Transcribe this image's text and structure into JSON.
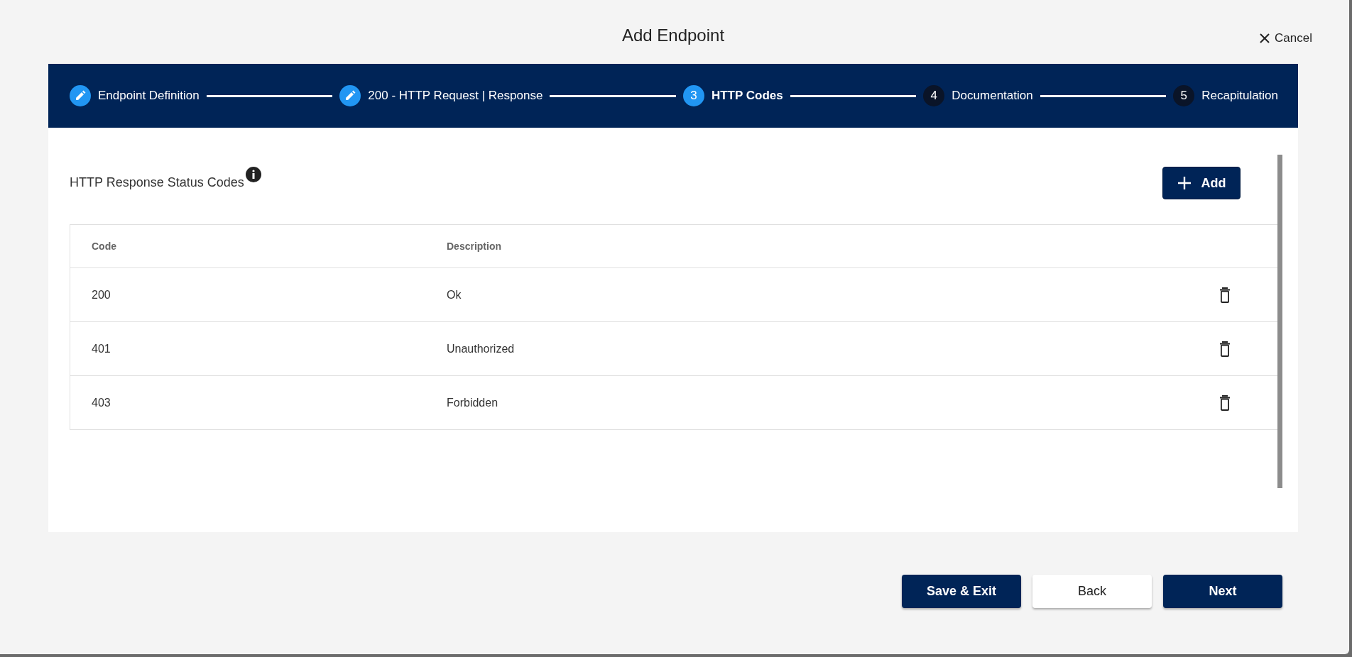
{
  "dialog": {
    "title": "Add Endpoint",
    "cancel": "Cancel"
  },
  "steps": [
    {
      "label": "Endpoint Definition",
      "completed": true,
      "selected": false
    },
    {
      "label": "200 - HTTP Request | Response",
      "completed": true,
      "selected": false
    },
    {
      "label": "HTTP Codes",
      "number": "3",
      "completed": false,
      "selected": true
    },
    {
      "label": "Documentation",
      "number": "4",
      "completed": false,
      "selected": false
    },
    {
      "label": "Recapitulation",
      "number": "5",
      "completed": false,
      "selected": false
    }
  ],
  "section": {
    "title": "HTTP Response Status Codes",
    "add_button": "Add"
  },
  "table": {
    "columns": [
      "Code",
      "Description"
    ],
    "rows": [
      {
        "code": "200",
        "description": "Ok"
      },
      {
        "code": "401",
        "description": "Unauthorized"
      },
      {
        "code": "403",
        "description": "Forbidden"
      }
    ]
  },
  "footer": {
    "buttons": [
      {
        "label": "Save & Exit",
        "kind": "primary"
      },
      {
        "label": "Back",
        "kind": "secondary"
      },
      {
        "label": "Next",
        "kind": "primary"
      }
    ]
  }
}
